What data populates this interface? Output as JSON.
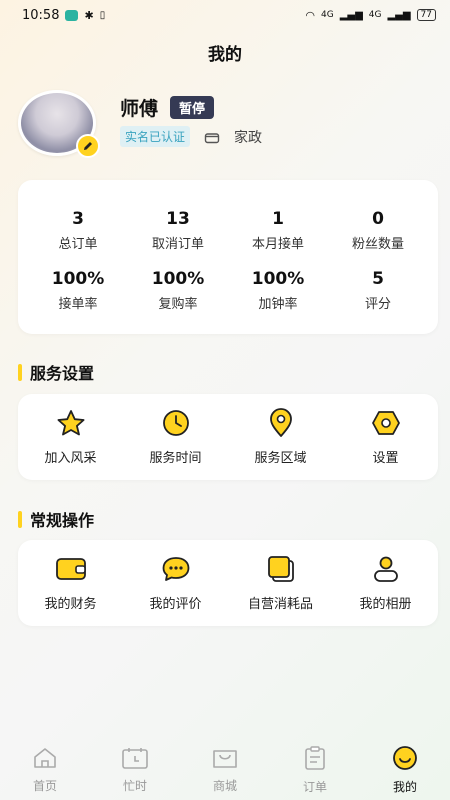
{
  "status_bar": {
    "time": "10:58",
    "battery": "77",
    "network_a": "4G",
    "network_b": "4G"
  },
  "header": {
    "title": "我的"
  },
  "profile": {
    "name": "师傅",
    "status": "暂停",
    "verified": "实名已认证",
    "category": "家政"
  },
  "stats": [
    {
      "value": "3",
      "label": "总订单"
    },
    {
      "value": "13",
      "label": "取消订单"
    },
    {
      "value": "1",
      "label": "本月接单"
    },
    {
      "value": "0",
      "label": "粉丝数量"
    },
    {
      "value": "100%",
      "label": "接单率"
    },
    {
      "value": "100%",
      "label": "复购率"
    },
    {
      "value": "100%",
      "label": "加钟率"
    },
    {
      "value": "5",
      "label": "评分"
    }
  ],
  "service_settings": {
    "title": "服务设置",
    "items": [
      {
        "label": "加入风采",
        "icon": "star-icon"
      },
      {
        "label": "服务时间",
        "icon": "clock-icon"
      },
      {
        "label": "服务区域",
        "icon": "location-pin-icon"
      },
      {
        "label": "设置",
        "icon": "settings-hexagon-icon"
      }
    ]
  },
  "common_actions": {
    "title": "常规操作",
    "items": [
      {
        "label": "我的财务",
        "icon": "wallet-icon"
      },
      {
        "label": "我的评价",
        "icon": "chat-bubble-icon"
      },
      {
        "label": "自营消耗品",
        "icon": "supplies-icon"
      },
      {
        "label": "我的相册",
        "icon": "person-album-icon"
      }
    ]
  },
  "tabbar": {
    "active": "我的",
    "items": [
      {
        "label": "首页",
        "icon": "home-icon"
      },
      {
        "label": "忙时",
        "icon": "calendar-icon"
      },
      {
        "label": "商城",
        "icon": "shop-bag-icon"
      },
      {
        "label": "订单",
        "icon": "clipboard-icon"
      },
      {
        "label": "我的",
        "icon": "smile-icon"
      }
    ]
  },
  "colors": {
    "accent": "#ffd21f",
    "pill": "#353a54",
    "verified_bg": "#dff0f4",
    "verified_text": "#3aa3bf"
  }
}
